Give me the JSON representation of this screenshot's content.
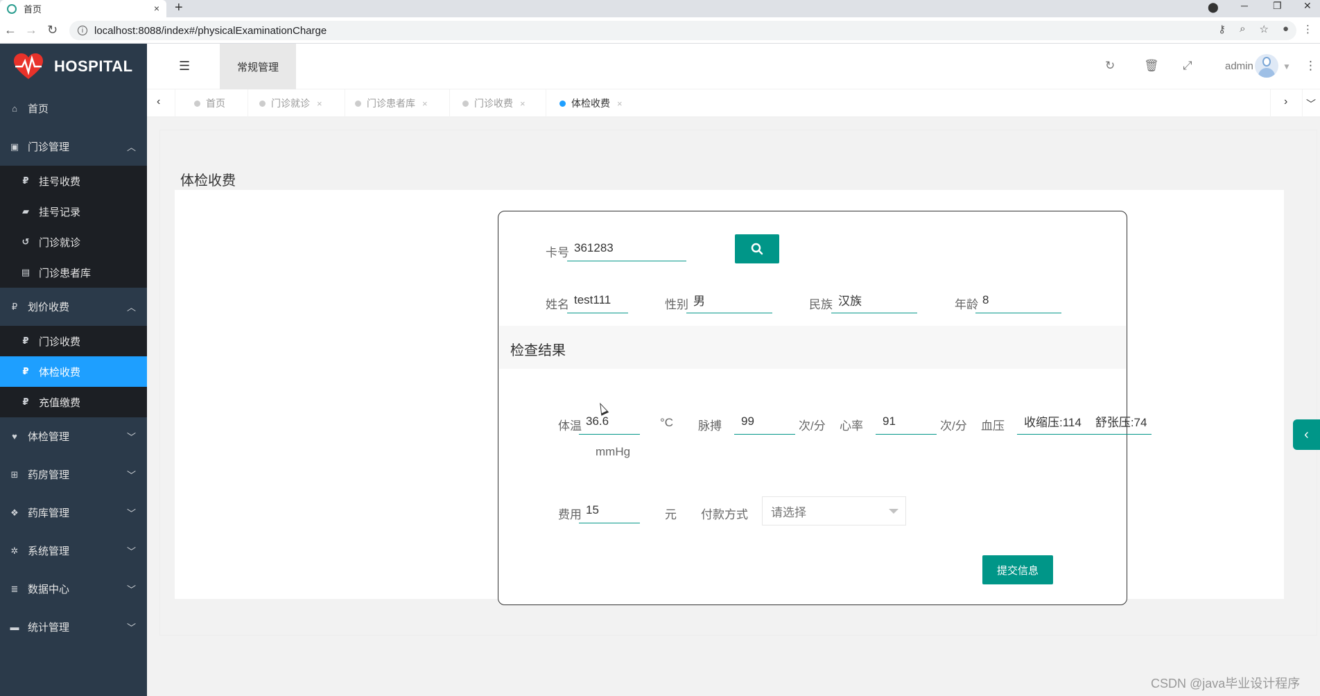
{
  "browser": {
    "tab_title": "首页",
    "tab_close": "×",
    "new_tab": "+",
    "url": "localhost:8088/index#/physicalExaminationCharge",
    "info_glyph": "i"
  },
  "sidebar": {
    "logo_text": "HOSPITAL",
    "home": "首页",
    "groups": [
      {
        "label": "门诊管理",
        "expanded": true,
        "items": [
          "挂号收费",
          "挂号记录",
          "门诊就诊",
          "门诊患者库"
        ]
      },
      {
        "label": "划价收费",
        "expanded": true,
        "items": [
          "门诊收费",
          "体检收费",
          "充值缴费"
        ]
      },
      {
        "label": "体检管理",
        "expanded": false
      },
      {
        "label": "药房管理",
        "expanded": false
      },
      {
        "label": "药库管理",
        "expanded": false
      },
      {
        "label": "系统管理",
        "expanded": false
      },
      {
        "label": "数据中心",
        "expanded": false
      },
      {
        "label": "统计管理",
        "expanded": false
      }
    ],
    "active_item": "体检收费",
    "active_color": "#1e9fff"
  },
  "header": {
    "nav_active": "常规管理",
    "user": "admin"
  },
  "page_tabs": [
    {
      "label": "首页",
      "closable": false
    },
    {
      "label": "门诊就诊",
      "closable": true
    },
    {
      "label": "门诊患者库",
      "closable": true
    },
    {
      "label": "门诊收费",
      "closable": true
    },
    {
      "label": "体检收费",
      "closable": true,
      "current": true
    }
  ],
  "page": {
    "title": "体检收费"
  },
  "form": {
    "card_label": "卡号",
    "card_value": "361283",
    "name_label": "姓名",
    "name_value": "test111",
    "gender_label": "性别",
    "gender_value": "男",
    "ethnicity_label": "民族",
    "ethnicity_value": "汉族",
    "age_label": "年龄",
    "age_value": "8",
    "section_title": "检查结果",
    "temp_label": "体温",
    "temp_value": "36.6",
    "temp_unit": "°C",
    "pulse_label": "脉搏",
    "pulse_value": "99",
    "pulse_unit": "次/分",
    "heart_label": "心率",
    "heart_value": "91",
    "heart_unit": "次/分",
    "bp_label": "血压",
    "bp_systolic": "收缩压:114",
    "bp_diastolic": "舒张压:74",
    "bp_unit": "mmHg",
    "fee_label": "费用",
    "fee_value": "15",
    "fee_unit": "元",
    "pay_label": "付款方式",
    "pay_placeholder": "请选择",
    "submit_label": "提交信息"
  },
  "watermark": "CSDN @java毕业设计程序",
  "colors": {
    "primary": "#009688",
    "sidebar_bg": "#2b3a4a",
    "submenu_bg": "#1c1f24"
  }
}
